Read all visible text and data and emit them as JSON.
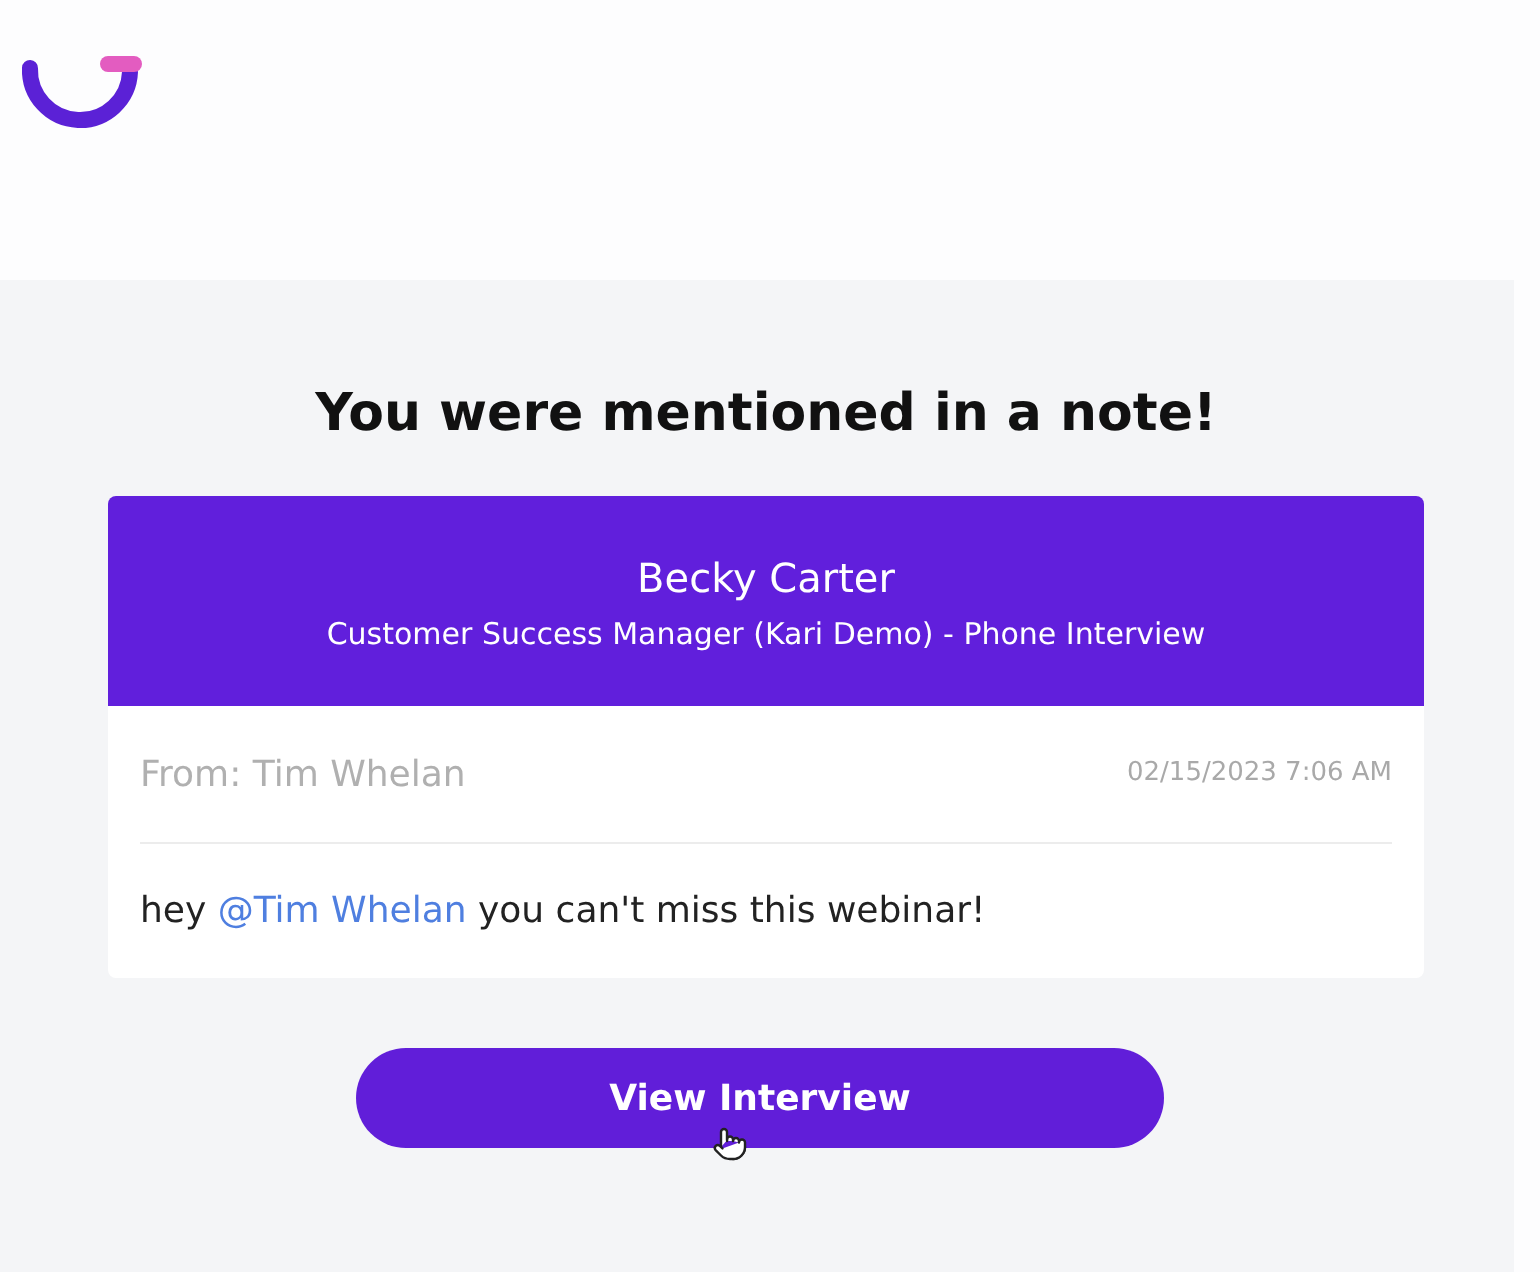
{
  "heading": "You were mentioned in a note!",
  "note": {
    "candidate": "Becky Carter",
    "context": "Customer Success Manager (Kari Demo) - Phone Interview",
    "from": "From: Tim Whelan",
    "timestamp": "02/15/2023 7:06 AM",
    "message": [
      {
        "kind": "text",
        "text": "hey "
      },
      {
        "kind": "mention",
        "text": "@Tim Whelan"
      },
      {
        "kind": "text",
        "text": " you can't miss this webinar!"
      }
    ]
  },
  "button": {
    "label": "View Interview"
  }
}
